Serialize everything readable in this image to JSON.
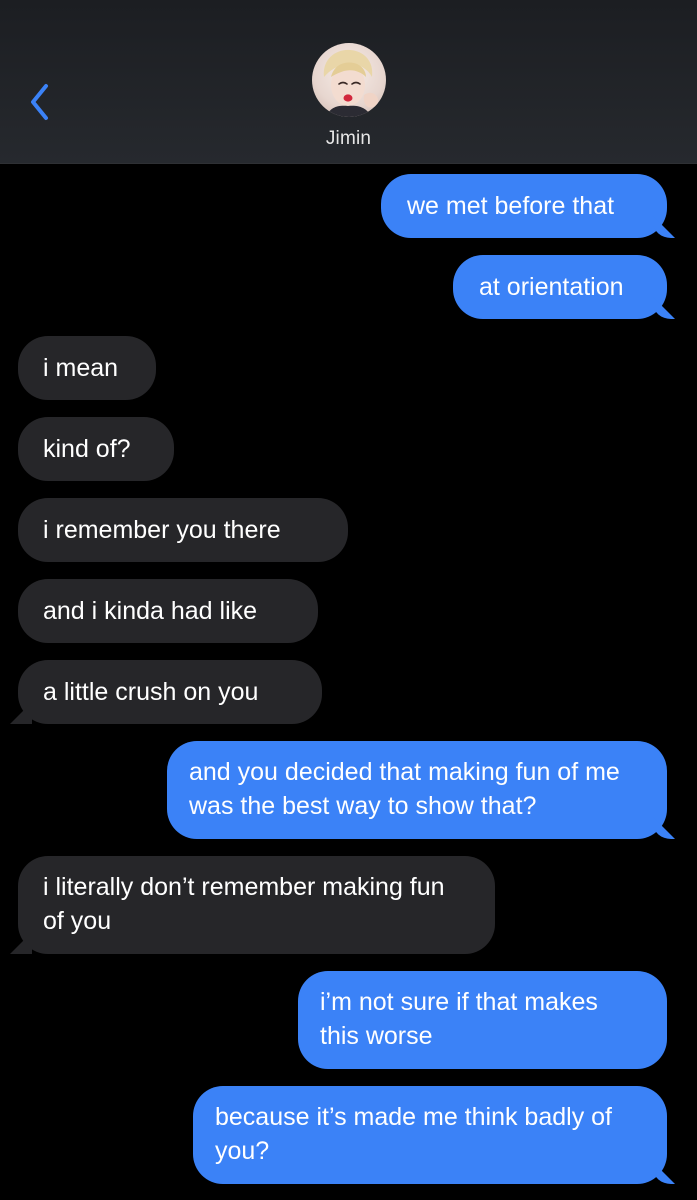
{
  "header": {
    "contact_name": "Jimin",
    "back_icon": "chevron-left-icon",
    "accent_color": "#3b82f7"
  },
  "messages": [
    {
      "direction": "outgoing",
      "text": "we met before that"
    },
    {
      "direction": "outgoing",
      "text": "at orientation"
    },
    {
      "direction": "incoming",
      "text": "i mean"
    },
    {
      "direction": "incoming",
      "text": "kind of?"
    },
    {
      "direction": "incoming",
      "text": "i remember you there"
    },
    {
      "direction": "incoming",
      "text": "and i kinda had like"
    },
    {
      "direction": "incoming",
      "text": "a little crush on you"
    },
    {
      "direction": "outgoing",
      "text": "and you decided that making fun of me was the best way to show that?"
    },
    {
      "direction": "incoming",
      "text": "i literally don’t remember making fun of you"
    },
    {
      "direction": "outgoing",
      "text": "i’m not sure if that makes this worse"
    },
    {
      "direction": "outgoing",
      "text": "because it’s made me think badly of you?"
    }
  ],
  "colors": {
    "outgoing_bubble": "#3b82f7",
    "incoming_bubble": "#262629",
    "background": "#000000"
  }
}
